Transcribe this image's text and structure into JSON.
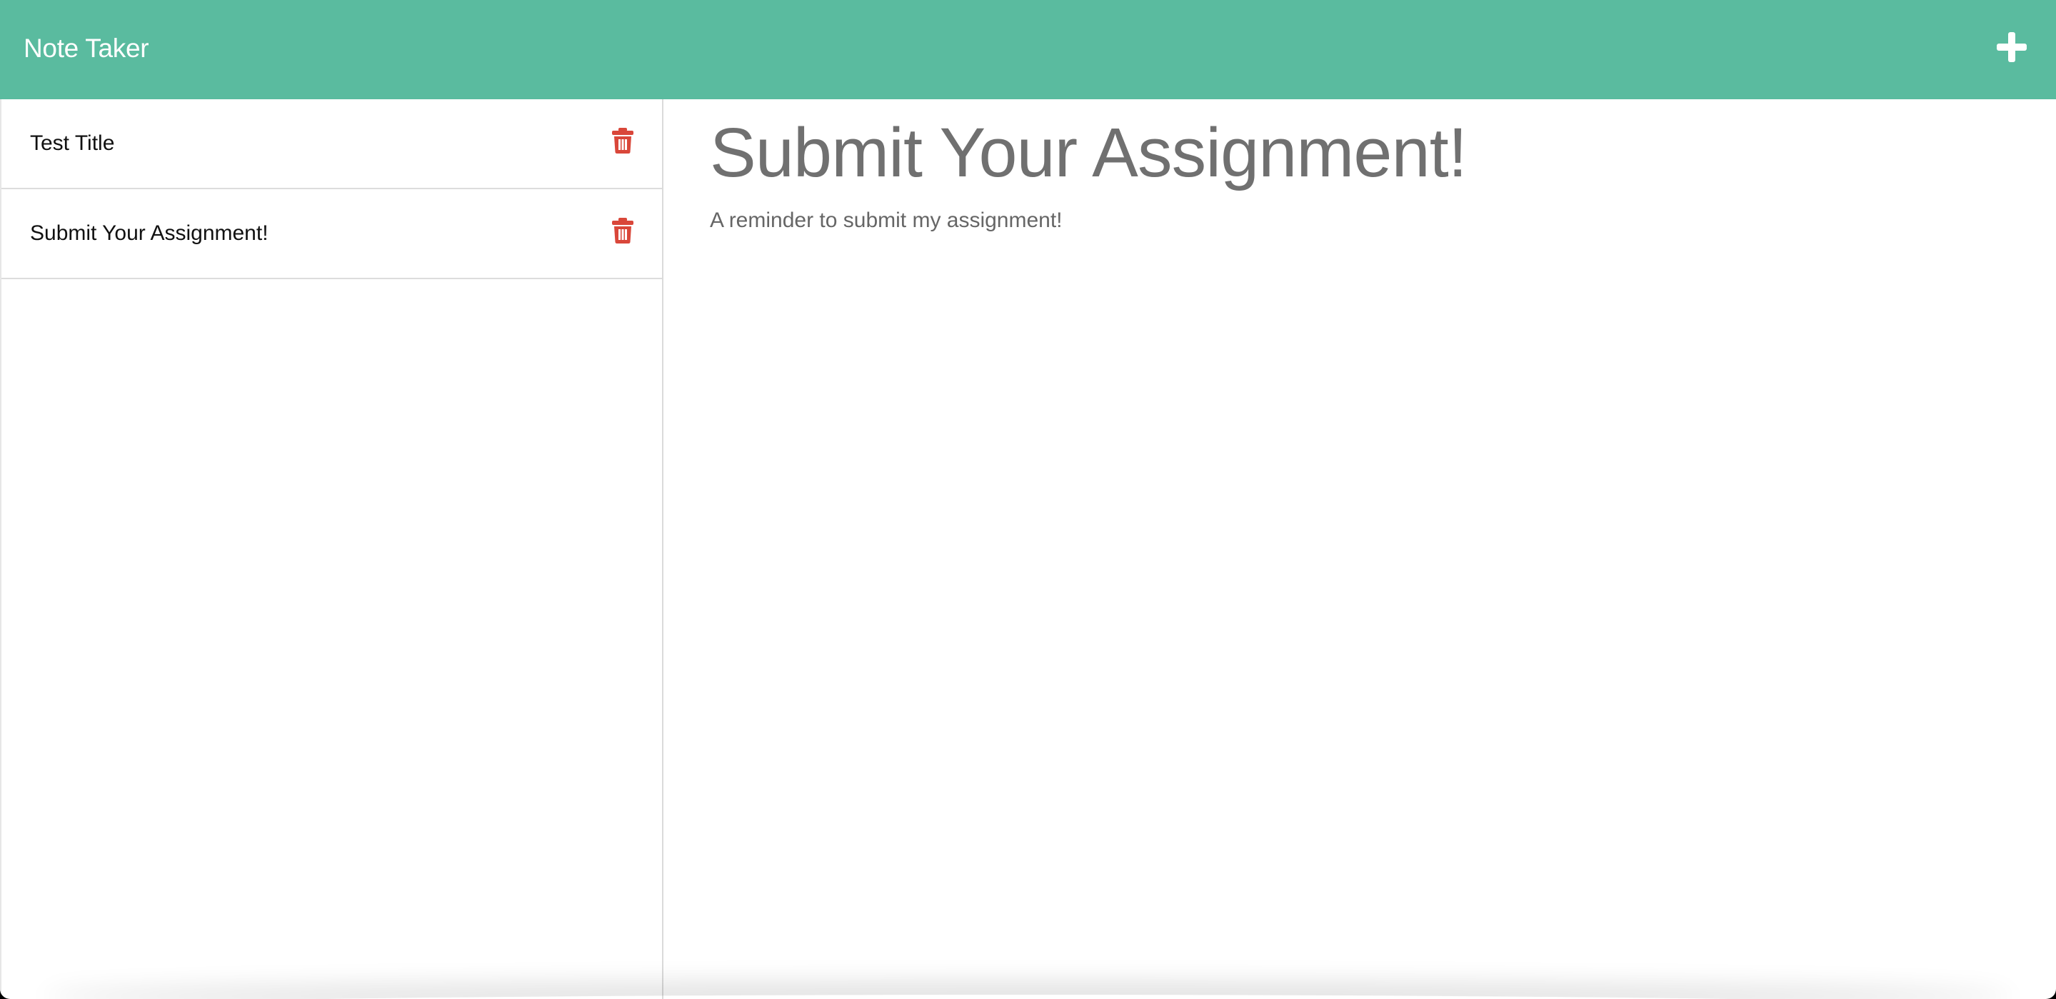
{
  "colors": {
    "accent": "#5abb9f",
    "delete_icon": "#d9473a",
    "heading": "#707070",
    "body_text": "#666666"
  },
  "navbar": {
    "brand": "Note Taker",
    "new_note_icon": "plus-icon"
  },
  "sidebar": {
    "notes": [
      {
        "title": "Test Title",
        "delete_icon": "trash-icon"
      },
      {
        "title": "Submit Your Assignment!",
        "delete_icon": "trash-icon"
      }
    ]
  },
  "main": {
    "title": "Submit Your Assignment!",
    "text": "A reminder to submit my assignment!"
  }
}
